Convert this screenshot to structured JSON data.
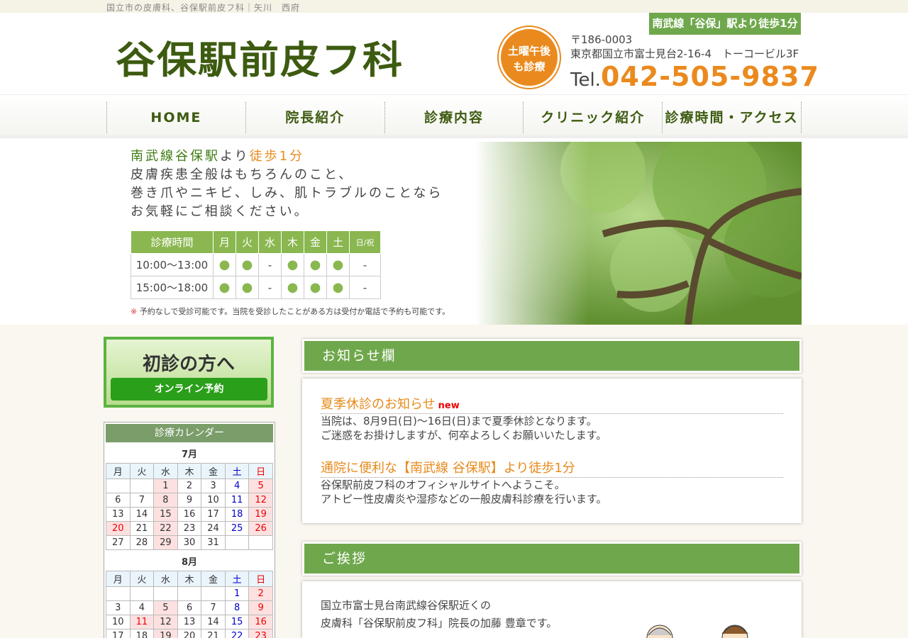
{
  "topbar": {
    "text": "国立市の皮膚科、谷保駅前皮フ科｜矢川　西府"
  },
  "header": {
    "logo": "谷保駅前皮フ科",
    "station_badge": "南武線「谷保」駅より徒歩1分",
    "sat_badge_line1": "土曜午後",
    "sat_badge_line2": "も診療",
    "postal": "〒186-0003",
    "address": "東京都国立市富士見台2-16-4　トーコービル3F",
    "tel_prefix": "Tel.",
    "tel": "042-505-9837"
  },
  "nav": {
    "items": [
      "HOME",
      "院長紹介",
      "診療内容",
      "クリニック紹介",
      "診療時間・アクセス"
    ]
  },
  "hero": {
    "line1_a": "南武線谷保駅",
    "line1_b": "より",
    "line1_c": "徒歩1分",
    "line2": "皮膚疾患全般はもちろんのこと、",
    "line3": "巻き爪やニキビ、しみ、肌トラブルのことなら",
    "line4": "お気軽にご相談ください。",
    "hours": {
      "header": [
        "診療時間",
        "月",
        "火",
        "水",
        "木",
        "金",
        "土",
        "日/祝"
      ],
      "rows": [
        {
          "time": "10:00〜13:00",
          "cells": [
            "●",
            "●",
            "-",
            "●",
            "●",
            "●",
            "-"
          ]
        },
        {
          "time": "15:00〜18:00",
          "cells": [
            "●",
            "●",
            "-",
            "●",
            "●",
            "●",
            "-"
          ]
        }
      ]
    },
    "note_mark": "※",
    "note": "予約なしで受診可能です。当院を受診したことがある方は受付か電話で予約も可能です。"
  },
  "sidebar": {
    "first_visit_title": "初診の方へ",
    "first_visit_button": "オンライン予約",
    "calendar_title": "診療カレンダー",
    "weekdays": [
      "月",
      "火",
      "水",
      "木",
      "金",
      "土",
      "日"
    ],
    "months": [
      {
        "label": "7月",
        "weeks": [
          [
            "",
            "",
            "1",
            "2",
            "3",
            "4",
            "5"
          ],
          [
            "6",
            "7",
            "8",
            "9",
            "10",
            "11",
            "12"
          ],
          [
            "13",
            "14",
            "15",
            "16",
            "17",
            "18",
            "19"
          ],
          [
            "20",
            "21",
            "22",
            "23",
            "24",
            "25",
            "26"
          ],
          [
            "27",
            "28",
            "29",
            "30",
            "31",
            "",
            ""
          ]
        ]
      },
      {
        "label": "8月",
        "weeks": [
          [
            "",
            "",
            "",
            "",
            "",
            "1",
            "2"
          ],
          [
            "3",
            "4",
            "5",
            "6",
            "7",
            "8",
            "9"
          ],
          [
            "10",
            "11",
            "12",
            "13",
            "14",
            "15",
            "16"
          ],
          [
            "17",
            "18",
            "19",
            "20",
            "21",
            "22",
            "23"
          ]
        ]
      }
    ]
  },
  "news": {
    "title": "お知らせ欄",
    "items": [
      {
        "title": "夏季休診のお知らせ",
        "badge": "new",
        "body1": "当院は、8月9日(日)～16日(日)まで夏季休診となります。",
        "body2": "ご迷惑をお掛けしますが、何卒よろしくお願いいたします。"
      },
      {
        "title": "通院に便利な【南武線 谷保駅】より徒歩1分",
        "badge": "",
        "body1": "谷保駅前皮フ科のオフィシャルサイトへようこそ。",
        "body2": "アトピー性皮膚炎や湿疹などの一般皮膚科診療を行います。"
      }
    ]
  },
  "greeting": {
    "title": "ご挨拶",
    "line1": "国立市富士見台南武線谷保駅近くの",
    "line2": "皮膚科「谷保駅前皮フ科」院長の加藤 豊章です。"
  },
  "colors": {
    "accent_green": "#6fa84c",
    "accent_orange": "#ea8a1e",
    "logo_green": "#3d5b10"
  }
}
